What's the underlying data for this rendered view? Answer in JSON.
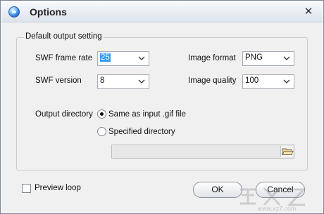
{
  "window": {
    "title": "Options",
    "close_label": "✕"
  },
  "group": {
    "legend": "Default output setting"
  },
  "swf_frame_rate": {
    "label": "SWF frame rate",
    "value": "25"
  },
  "swf_version": {
    "label": "SWF version",
    "value": "8"
  },
  "image_format": {
    "label": "Image format",
    "value": "PNG"
  },
  "image_quality": {
    "label": "Image quality",
    "value": "100"
  },
  "output": {
    "label": "Output directory",
    "option_same": "Same as input .gif file",
    "option_specified": "Specified directory",
    "selected": "same",
    "path_value": ""
  },
  "preview_loop": {
    "label": "Preview loop",
    "checked": false
  },
  "buttons": {
    "ok": "OK",
    "cancel": "Cancel"
  },
  "icons": {
    "app": "app-orb-icon",
    "close": "close-icon",
    "dropdown": "chevron-down-icon",
    "folder": "folder-open-icon",
    "watermark": "watermark-logo"
  },
  "colors": {
    "selection": "#3399ff",
    "window_bg": "#f0f0f0"
  },
  "watermark": {
    "text": "www.xz7.com"
  }
}
